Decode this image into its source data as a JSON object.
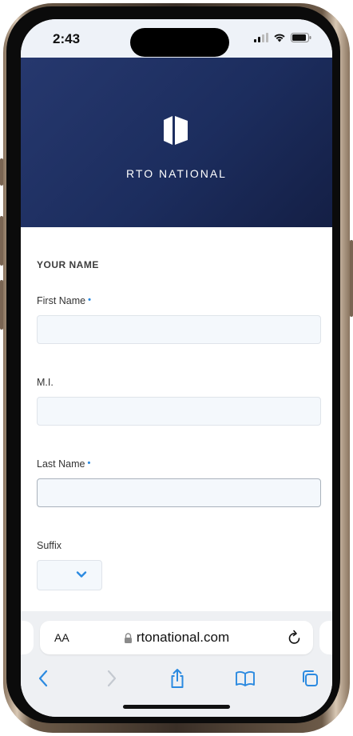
{
  "status_bar": {
    "time": "2:43"
  },
  "brand": {
    "name": "RTO NATIONAL"
  },
  "form": {
    "section_title": "YOUR NAME",
    "fields": [
      {
        "label": "First Name",
        "required": true,
        "value": ""
      },
      {
        "label": "M.I.",
        "required": false,
        "value": ""
      },
      {
        "label": "Last Name",
        "required": true,
        "value": ""
      }
    ],
    "suffix": {
      "label": "Suffix",
      "selected": ""
    },
    "required_marker": "•"
  },
  "browser": {
    "text_size_label": "AA",
    "url": "rtonational.com"
  },
  "colors": {
    "hero": "#1c2d5e",
    "required": "#2b8ae0",
    "accent": "#2b8ae0"
  },
  "icons": [
    "signal-icon",
    "wifi-icon",
    "battery-icon",
    "lock-icon",
    "reload-icon",
    "back-icon",
    "forward-icon",
    "share-icon",
    "bookmarks-icon",
    "tabs-icon",
    "chevron-down-icon"
  ]
}
